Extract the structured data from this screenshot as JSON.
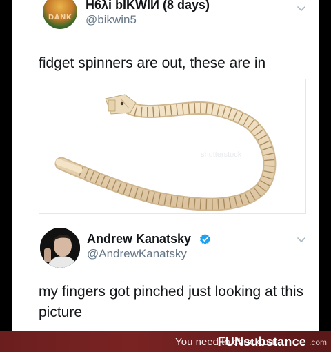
{
  "tweets": [
    {
      "display_name": "H6λi bIKWIИ (8 days)",
      "handle": "@bikwin5",
      "avatar_text": "DANK",
      "text": "fidget spinners are out, these are in",
      "media": {
        "subject": "wooden toy snake",
        "watermark": "shutterstock"
      }
    },
    {
      "display_name": "Andrew Kanatsky",
      "handle": "@AndrewKanatsky",
      "verified": true,
      "text": "my fingers got pinched just looking at this picture"
    }
  ],
  "footer": {
    "caption": "You need to check out",
    "brand": "FUNsubstance",
    "brand_suffix": ".com"
  },
  "colors": {
    "background": "#000000",
    "card": "#ffffff",
    "name": "#14171a",
    "handle": "#657786",
    "verified": "#1da1f2",
    "footer": "#6b1e1e"
  },
  "icons": {
    "verified": "verified-badge-icon",
    "caret": "chevron-down-icon"
  }
}
